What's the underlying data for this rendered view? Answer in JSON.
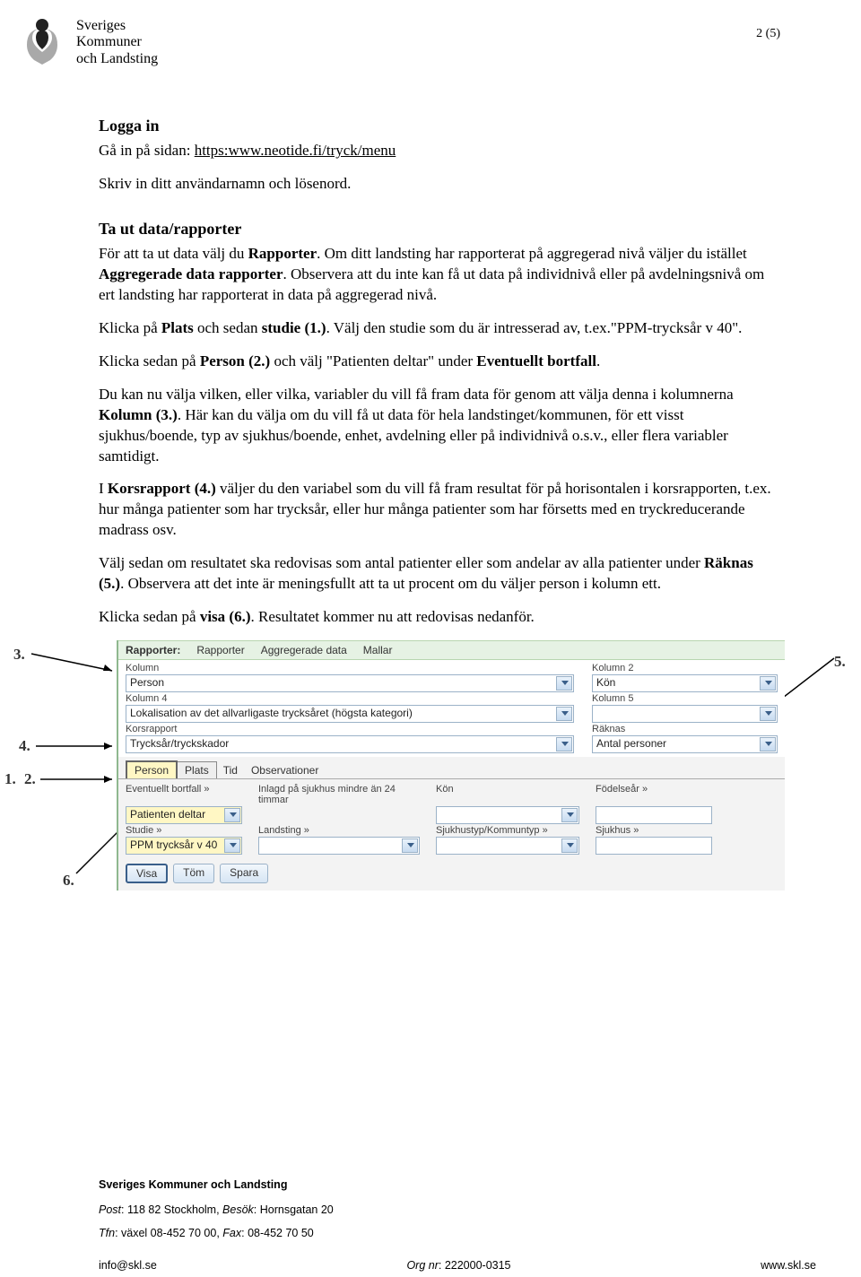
{
  "header": {
    "org_lines": [
      "Sveriges",
      "Kommuner",
      "och Landsting"
    ],
    "page_num": "2 (5)"
  },
  "login": {
    "heading": "Logga in",
    "p1_pre": "Gå in på sidan: ",
    "p1_url": "https:www.neotide.fi/tryck/menu",
    "p2": "Skriv in ditt användarnamn och lösenord."
  },
  "report": {
    "heading": "Ta ut data/rapporter",
    "p1": "För att ta ut data välj du Rapporter. Om ditt landsting har rapporterat på aggregerad nivå väljer du istället Aggregerade data rapporter. Observera att du inte kan få ut data på individnivå eller på avdelningsnivå om ert landsting har rapporterat in data på aggregerad nivå.",
    "p2": "Klicka på Plats och sedan studie (1.). Välj den studie som du är intresserad av, t.ex.\"PPM-trycksår v 40\".",
    "p3": "Klicka sedan på Person (2.) och välj \"Patienten deltar\" under Eventuellt bortfall.",
    "p4": "Du kan nu välja vilken, eller vilka, variabler du vill få fram data för genom att välja denna i kolumnerna Kolumn (3.). Här kan du välja om du vill få ut data för hela landstinget/kommunen, för ett visst sjukhus/boende, typ av sjukhus/boende, enhet, avdelning eller på individnivå o.s.v., eller flera variabler samtidigt.",
    "p5": "I Korsrapport (4.) väljer du den variabel som du vill få fram resultat för på horisontalen i korsrapporten, t.ex. hur många patienter som har trycksår, eller hur många patienter som har försetts med en tryckreducerande madrass osv.",
    "p6": "Välj sedan om resultatet ska redovisas som antal patienter eller som andelar av alla patienter under Räknas (5.). Observera att det inte är meningsfullt att ta ut procent om du väljer person i kolumn ett.",
    "p7": "Klicka sedan på visa (6.). Resultatet kommer nu att redovisas nedanför."
  },
  "callouts": {
    "c1": "1.",
    "c2": "2.",
    "c3": "3.",
    "c4": "4.",
    "c5": "5.",
    "c6": "6."
  },
  "ui": {
    "topbar": {
      "label": "Rapporter:",
      "items": [
        "Rapporter",
        "Aggregerade data",
        "Mallar"
      ]
    },
    "cols": {
      "k1_label": "Kolumn",
      "k1_val": "Person",
      "k2_label": "Kolumn 2",
      "k2_val": "Kön",
      "k4_label": "Kolumn 4",
      "k4_val": "Lokalisation av det allvarligaste trycksåret (högsta kategori)",
      "k5_label": "Kolumn 5",
      "k5_val": "",
      "kors_label": "Korsrapport",
      "kors_val": "Trycksår/tryckskador",
      "rak_label": "Räknas",
      "rak_val": "Antal personer"
    },
    "tabs": {
      "person": "Person",
      "plats": "Plats",
      "tid": "Tid",
      "obs": "Observationer"
    },
    "filters": {
      "ev_label": "Eventuellt bortfall »",
      "ev_val": "Patienten deltar",
      "inlagd_label": "Inlagd på sjukhus mindre än 24 timmar",
      "kon_label": "Kön",
      "kon_val": "",
      "fod_label": "Födelseår »",
      "studie_label": "Studie »",
      "studie_val": "PPM trycksår v 40",
      "land_label": "Landsting »",
      "land_val": "",
      "sjtyp_label": "Sjukhustyp/Kommuntyp »",
      "sjtyp_val": "",
      "sjuk_label": "Sjukhus »"
    },
    "buttons": {
      "visa": "Visa",
      "tom": "Töm",
      "spara": "Spara"
    }
  },
  "footer": {
    "title": "Sveriges Kommuner och Landsting",
    "post_lbl": "Post",
    "post_val": ": 118 82 Stockholm, ",
    "besok_lbl": "Besök",
    "besok_val": ": Hornsgatan 20",
    "tfn_lbl": "Tfn",
    "tfn_val": ": växel 08-452 70 00, ",
    "fax_lbl": "Fax",
    "fax_val": ": 08-452 70 50",
    "email": "info@skl.se",
    "org_lbl": "Org nr",
    "org_val": ": 222000-0315",
    "web": "www.skl.se"
  }
}
